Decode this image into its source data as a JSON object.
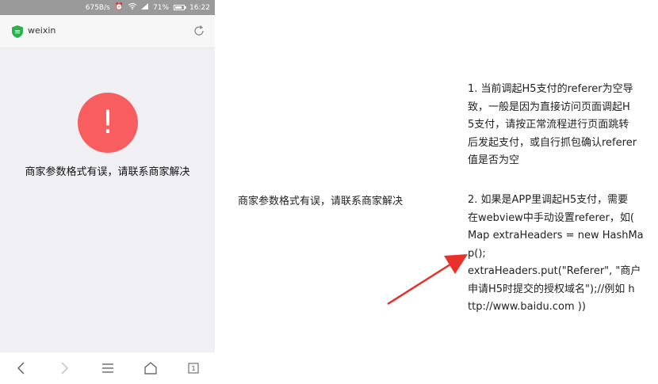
{
  "status_bar": {
    "speed": "675B/s",
    "battery": "71%",
    "time": "16:22"
  },
  "address_bar": {
    "site": "weixin"
  },
  "error": {
    "symbol": "!",
    "message": "商家参数格式有误，请联系商家解决"
  },
  "nav": {
    "tabs_count": "1"
  },
  "annotation": {
    "middle_text": "商家参数格式有误，请联系商家解决",
    "note1_lines": [
      "1. 当前调起H5支付的referer为空导",
      "致，一般是因为直接访问页面调起H",
      "5支付，请按正常流程进行页面跳转",
      "后发起支付，或自行抓包确认referer",
      "值是否为空"
    ],
    "note2_lines": [
      "2. 如果是APP里调起H5支付，需要",
      "在webview中手动设置referer，如(",
      "Map extraHeaders = new HashMa",
      "p();",
      "extraHeaders.put(\"Referer\", \"商户",
      "申请H5时提交的授权域名\");//例如 h",
      "ttp://www.baidu.com ))"
    ]
  },
  "colors": {
    "error_red": "#f85e5f",
    "arrow_red": "#e8312a",
    "shield_green": "#2bb24c"
  }
}
